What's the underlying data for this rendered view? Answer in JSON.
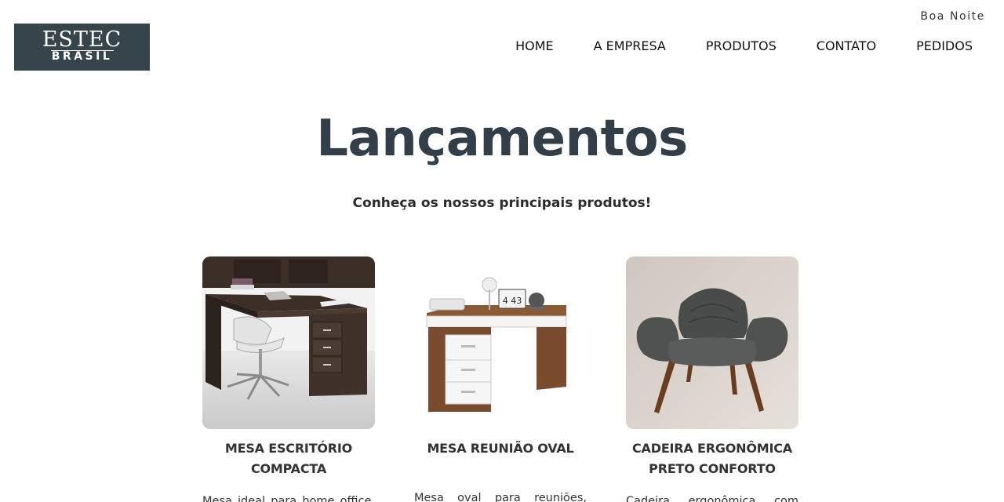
{
  "header": {
    "greeting": "Boa Noite",
    "logo": {
      "line1": "ESTEC",
      "line2": "BRASIL"
    },
    "nav": [
      "HOME",
      "A EMPRESA",
      "PRODUTOS",
      "CONTATO",
      "PEDIDOS"
    ]
  },
  "main": {
    "title": "Lançamentos",
    "subtitle": "Conheça os nossos principais produtos!",
    "products": [
      {
        "name": "MESA ESCRITÓRIO COMPACTA",
        "description": "Mesa ideal para home office,",
        "image_icon": "office-desk-image"
      },
      {
        "name": "MESA REUNIÃO OVAL",
        "description": "Mesa oval para reuniões,",
        "image_icon": "meeting-desk-image",
        "clock_text": "4 43"
      },
      {
        "name": "CADEIRA ERGONÔMICA PRETO CONFORTO",
        "description": "Cadeira ergonômica com",
        "image_icon": "armchair-image"
      }
    ]
  },
  "colors": {
    "logo_bg": "#36444c",
    "title": "#333f48"
  }
}
